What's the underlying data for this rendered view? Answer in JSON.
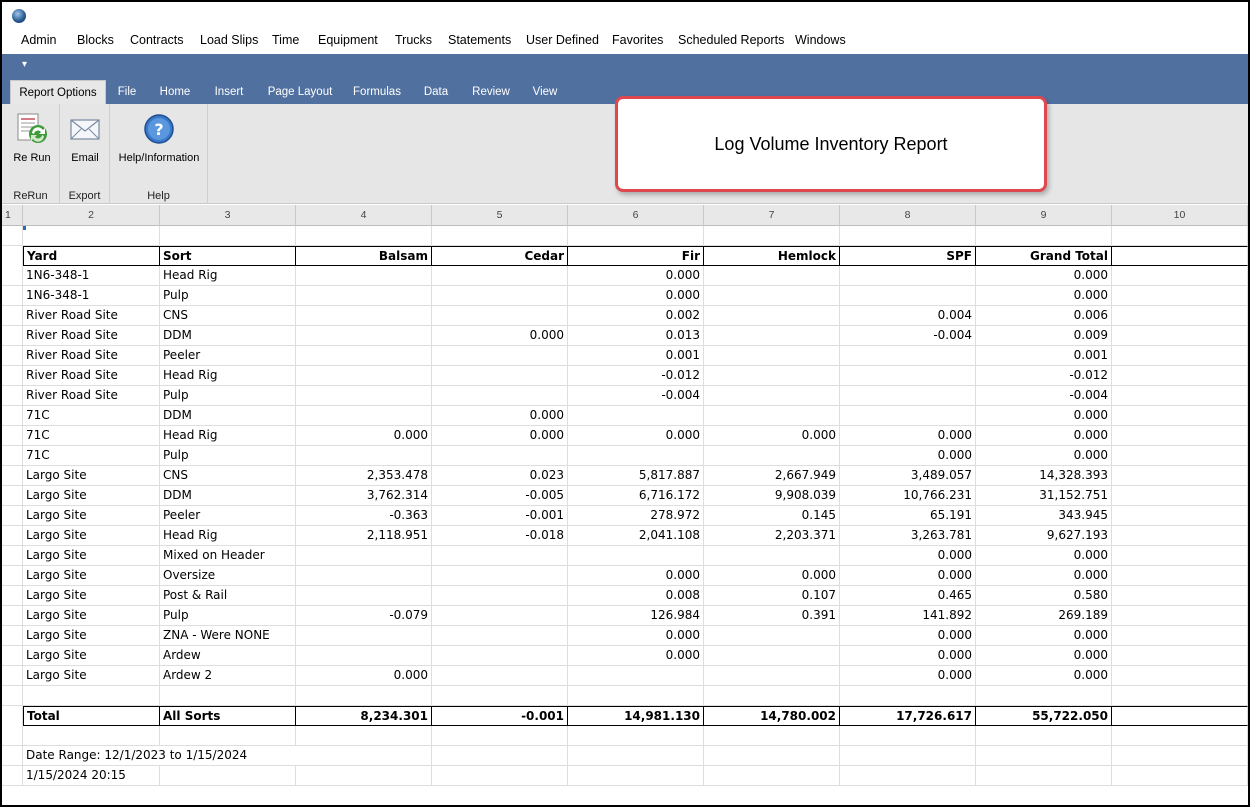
{
  "menu": [
    "Admin",
    "Blocks",
    "Contracts",
    "Load Slips",
    "Time",
    "Equipment",
    "Trucks",
    "Statements",
    "User Defined",
    "Favorites",
    "Scheduled Reports",
    "Windows"
  ],
  "quick_access_arrow": "▾",
  "tabs": [
    "Report Options",
    "File",
    "Home",
    "Insert",
    "Page Layout",
    "Formulas",
    "Data",
    "Review",
    "View"
  ],
  "ribbon": {
    "rerun_label": "Re Run",
    "email_label": "Email",
    "help_label": "Help/Information",
    "group_rerun": "ReRun",
    "group_export": "Export",
    "group_help": "Help"
  },
  "report_title": "Log Volume Inventory Report",
  "column_numbers": [
    "1",
    "2",
    "3",
    "4",
    "5",
    "6",
    "7",
    "8",
    "9",
    "10"
  ],
  "table": {
    "headers": [
      "Yard",
      "Sort",
      "Balsam",
      "Cedar",
      "Fir",
      "Hemlock",
      "SPF",
      "Grand Total"
    ],
    "rows": [
      [
        "1N6-348-1",
        "Head Rig",
        "",
        "",
        "0.000",
        "",
        "",
        "0.000"
      ],
      [
        "1N6-348-1",
        "Pulp",
        "",
        "",
        "0.000",
        "",
        "",
        "0.000"
      ],
      [
        "River Road Site",
        "CNS",
        "",
        "",
        "0.002",
        "",
        "0.004",
        "0.006"
      ],
      [
        "River Road Site",
        "DDM",
        "",
        "0.000",
        "0.013",
        "",
        "-0.004",
        "0.009"
      ],
      [
        "River Road Site",
        "Peeler",
        "",
        "",
        "0.001",
        "",
        "",
        "0.001"
      ],
      [
        "River Road Site",
        "Head Rig",
        "",
        "",
        "-0.012",
        "",
        "",
        "-0.012"
      ],
      [
        "River Road Site",
        "Pulp",
        "",
        "",
        "-0.004",
        "",
        "",
        "-0.004"
      ],
      [
        "71C",
        "DDM",
        "",
        "0.000",
        "",
        "",
        "",
        "0.000"
      ],
      [
        "71C",
        "Head Rig",
        "0.000",
        "0.000",
        "0.000",
        "0.000",
        "0.000",
        "0.000"
      ],
      [
        "71C",
        "Pulp",
        "",
        "",
        "",
        "",
        "0.000",
        "0.000"
      ],
      [
        "Largo Site",
        "CNS",
        "2,353.478",
        "0.023",
        "5,817.887",
        "2,667.949",
        "3,489.057",
        "14,328.393"
      ],
      [
        "Largo Site",
        "DDM",
        "3,762.314",
        "-0.005",
        "6,716.172",
        "9,908.039",
        "10,766.231",
        "31,152.751"
      ],
      [
        "Largo Site",
        "Peeler",
        "-0.363",
        "-0.001",
        "278.972",
        "0.145",
        "65.191",
        "343.945"
      ],
      [
        "Largo Site",
        "Head Rig",
        "2,118.951",
        "-0.018",
        "2,041.108",
        "2,203.371",
        "3,263.781",
        "9,627.193"
      ],
      [
        "Largo Site",
        "Mixed on Header",
        "",
        "",
        "",
        "",
        "0.000",
        "0.000"
      ],
      [
        "Largo Site",
        "Oversize",
        "",
        "",
        "0.000",
        "0.000",
        "0.000",
        "0.000"
      ],
      [
        "Largo Site",
        "Post & Rail",
        "",
        "",
        "0.008",
        "0.107",
        "0.465",
        "0.580"
      ],
      [
        "Largo Site",
        "Pulp",
        "-0.079",
        "",
        "126.984",
        "0.391",
        "141.892",
        "269.189"
      ],
      [
        "Largo Site",
        "ZNA - Were NONE",
        "",
        "",
        "0.000",
        "",
        "0.000",
        "0.000"
      ],
      [
        "Largo Site",
        "Ardew",
        "",
        "",
        "0.000",
        "",
        "0.000",
        "0.000"
      ],
      [
        "Largo Site",
        "Ardew 2",
        "0.000",
        "",
        "",
        "",
        "0.000",
        "0.000"
      ]
    ],
    "total": [
      "Total",
      "All Sorts",
      "8,234.301",
      "-0.001",
      "14,981.130",
      "14,780.002",
      "17,726.617",
      "55,722.050"
    ]
  },
  "footer": {
    "date_range": "Date Range: 12/1/2023 to 1/15/2024",
    "timestamp": "1/15/2024 20:15"
  }
}
